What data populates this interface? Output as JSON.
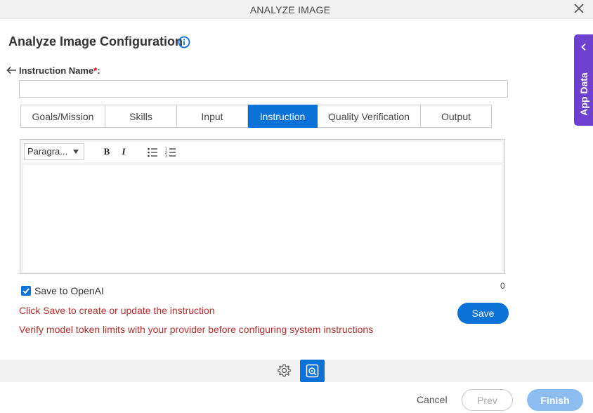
{
  "window": {
    "title": "ANALYZE IMAGE",
    "close_icon": "close-icon"
  },
  "page": {
    "heading": "Analyze Image Configuration",
    "info_icon": "info-icon",
    "back_icon": "arrow-left-icon"
  },
  "instruction_name": {
    "label": "Instruction Name",
    "required_mark": "*",
    "suffix": ":",
    "value": "",
    "placeholder": ""
  },
  "tabs": [
    {
      "label": "Goals/Mission",
      "active": false
    },
    {
      "label": "Skills",
      "active": false
    },
    {
      "label": "Input",
      "active": false
    },
    {
      "label": "Instruction",
      "active": true
    },
    {
      "label": "Quality Verification",
      "active": false
    },
    {
      "label": "Output",
      "active": false
    }
  ],
  "editor": {
    "paragraph_select": "Paragra...",
    "bold_label": "B",
    "italic_label": "I",
    "bullet_list_icon": "bulleted-list-icon",
    "numbered_list_icon": "numbered-list-icon",
    "content": ""
  },
  "char_count": "0",
  "save_to_openai": {
    "label": "Save to OpenAI",
    "checked": true
  },
  "messages": {
    "save_hint": "Click Save to create or update the instruction",
    "token_warning": "Verify model token limits with your provider before configuring system instructions"
  },
  "save_button": "Save",
  "side_panel": {
    "label": "App Data",
    "chevron_icon": "chevron-left-icon"
  },
  "bottom_toolbar": {
    "gear_icon": "gear-icon",
    "app_icon": "analyze-image-icon"
  },
  "footer": {
    "cancel": "Cancel",
    "prev": "Prev",
    "finish": "Finish"
  },
  "colors": {
    "primary": "#0b72d8",
    "side_tab": "#6f3fd0",
    "warning_text": "#b03030",
    "finish_disabled": "#8dbdf0"
  }
}
